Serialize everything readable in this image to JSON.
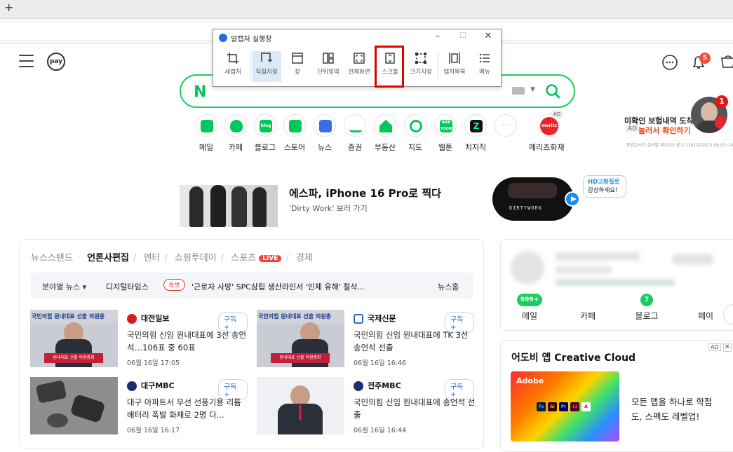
{
  "browser": {
    "new_tab_label": "+"
  },
  "capture_tool": {
    "title": "알캡처 실행창",
    "minimize": "–",
    "maximize": "☐",
    "close": "✕",
    "tools": [
      {
        "label": "새캡처",
        "icon": "crop-icon"
      },
      {
        "label": "직접지정",
        "icon": "select-region-icon",
        "active": true
      },
      {
        "label": "창",
        "icon": "window-icon"
      },
      {
        "label": "단위영역",
        "icon": "unit-area-icon"
      },
      {
        "label": "전체화면",
        "icon": "fullscreen-icon"
      },
      {
        "label": "스크롤",
        "icon": "scroll-capture-icon",
        "highlighted": true
      },
      {
        "label": "크기지정",
        "icon": "size-icon"
      },
      {
        "label": "캡처목록",
        "icon": "capture-list-icon"
      },
      {
        "label": "메뉴",
        "icon": "menu-icon"
      }
    ]
  },
  "header": {
    "pay_label": "pay",
    "notification_count": "5"
  },
  "search": {
    "logo": "N",
    "placeholder": ""
  },
  "shortcuts": [
    {
      "label": "메일",
      "color": "#03c75a"
    },
    {
      "label": "카페",
      "color": "#03c75a"
    },
    {
      "label": "블로그",
      "color": "#03c75a",
      "text": "blog"
    },
    {
      "label": "스토어",
      "color": "#03c75a"
    },
    {
      "label": "뉴스",
      "color": "#3b6ee6"
    },
    {
      "label": "증권",
      "color": "#03c75a"
    },
    {
      "label": "부동산",
      "color": "#03c75a"
    },
    {
      "label": "지도",
      "color": "#03c75a"
    },
    {
      "label": "웹툰",
      "color": "#03c75a",
      "text": "WEB\nTOON"
    },
    {
      "label": "치지직",
      "color": "#111111"
    },
    {
      "label": "",
      "color": "#dddddd"
    },
    {
      "label": "메리츠화재",
      "color": "#e8252b",
      "text": "meritz",
      "ad": "AD"
    }
  ],
  "insurance_ad": {
    "line1": "미확인 보험내역 도착",
    "ad_tag": "AD",
    "line2": "놀러서 확인하기",
    "note": "준법감시인 심의필 제2025-광고-1161호(2025.06.05~2026.06.04)",
    "badge": "1"
  },
  "apple_banner": {
    "apple_logo": "",
    "title": "에스파, iPhone 16 Pro로 찍다",
    "subtitle": "'Dirty Work' 보러 가기",
    "hd_line1": "HD고화질로",
    "hd_line2": "감상하세요!",
    "phone_text": "DIRTYWORK"
  },
  "news": {
    "tabs": [
      {
        "label": "뉴스스탠드",
        "active": false
      },
      {
        "label": "언론사편집",
        "active": true
      },
      {
        "label": "엔터",
        "active": false
      },
      {
        "label": "쇼핑투데이",
        "active": false
      },
      {
        "label": "스포츠",
        "active": false,
        "live": "LIVE"
      },
      {
        "label": "경제",
        "active": false
      }
    ],
    "ticker": {
      "category": "분야별 뉴스 ▾",
      "press": "디지털타임스",
      "badge": "속보",
      "headline": "'근로자 사망' SPC삼립 생산라인서 '인체 유해' 절삭...",
      "home": "뉴스홈"
    },
    "items": [
      {
        "press": "대전일보",
        "subscribe": "구독 +",
        "headline": "국민의힘 신임 원내대표에 3선 송언석…106표 중 60표",
        "time": "06월 16일 17:05",
        "logo_color": "#d21f26"
      },
      {
        "press": "국제신문",
        "subscribe": "구독 +",
        "headline": "국민의힘 신임 원내대표에 TK 3선 송언석 선출",
        "time": "06월 16일 16:46",
        "logo_color": "#2b6fc0"
      },
      {
        "press": "대구MBC",
        "subscribe": "구독 +",
        "headline": "대구 아파트서 무선 선풍기용 리튬 배터리 폭발 화재로 2명 다...",
        "time": "06월 16일 16:17",
        "logo_color": "#1a2f6b"
      },
      {
        "press": "전주MBC",
        "subscribe": "구독 +",
        "headline": "국민의힘 신임 원내대표에 송언석 선출",
        "time": "06월 16일 16:44",
        "logo_color": "#1a2f6b"
      }
    ],
    "thumb_caption": "국민의힘 원내대표 선출 의원총",
    "thumb_banner": "원내대표 선출 의원총회"
  },
  "profile": {
    "stats": [
      {
        "label": "메일",
        "badge": "999+"
      },
      {
        "label": "카페",
        "badge": ""
      },
      {
        "label": "블로그",
        "badge": "7"
      },
      {
        "label": "페이",
        "badge": ""
      }
    ]
  },
  "adobe_ad": {
    "title": "어도비 앱 Creative Cloud",
    "ad_tag": "AD",
    "close": "✕",
    "brand": "Adobe",
    "desc": "모든 앱을 하나로 학점도, 스펙도 레벨업!",
    "apps": [
      "Ps",
      "Ai",
      "Pr",
      "Id",
      "A"
    ]
  },
  "colors": {
    "naver_green": "#03c75a",
    "highlight_red": "#e00000",
    "live_red": "#f0413b",
    "subscribe_blue": "#2a6cd1"
  }
}
